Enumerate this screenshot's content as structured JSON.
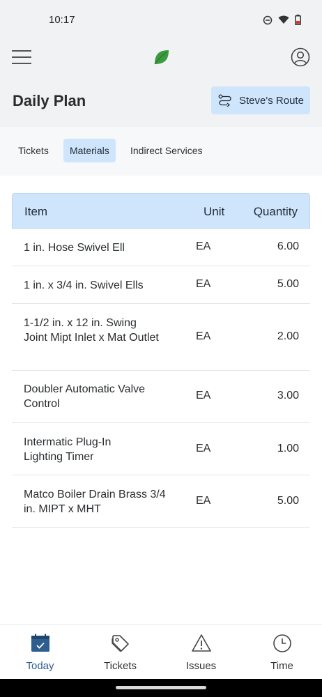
{
  "status_bar": {
    "time": "10:17"
  },
  "header": {
    "title": "Daily Plan",
    "route_button_label": "Steve's Route"
  },
  "tabs": [
    {
      "label": "Tickets",
      "active": false
    },
    {
      "label": "Materials",
      "active": true
    },
    {
      "label": "Indirect Services",
      "active": false
    }
  ],
  "table": {
    "columns": {
      "item": "Item",
      "unit": "Unit",
      "quantity": "Quantity"
    },
    "rows": [
      {
        "item": "1 in. Hose Swivel Ell",
        "unit": "EA",
        "quantity": "6.00"
      },
      {
        "item": "1 in. x 3/4 in. Swivel Ells",
        "unit": "EA",
        "quantity": "5.00"
      },
      {
        "item": "1-1/2 in. x 12 in. Swing Joint Mipt Inlet x Mat Outlet",
        "unit": "EA",
        "quantity": "2.00"
      },
      {
        "item": "Doubler Automatic Valve Control",
        "unit": "EA",
        "quantity": "3.00"
      },
      {
        "item": "Intermatic Plug-In Lighting Timer",
        "unit": "EA",
        "quantity": "1.00"
      },
      {
        "item": "Matco Boiler Drain Brass 3/4 in. MIPT x MHT",
        "unit": "EA",
        "quantity": "5.00"
      }
    ]
  },
  "bottom_nav": [
    {
      "label": "Today",
      "icon": "calendar-check-icon",
      "active": true
    },
    {
      "label": "Tickets",
      "icon": "tag-icon",
      "active": false
    },
    {
      "label": "Issues",
      "icon": "warning-triangle-icon",
      "active": false
    },
    {
      "label": "Time",
      "icon": "clock-icon",
      "active": false
    }
  ],
  "colors": {
    "accent": "#cfe5fb",
    "brand_green": "#3a9a3f",
    "active_nav": "#2e5d8f"
  }
}
